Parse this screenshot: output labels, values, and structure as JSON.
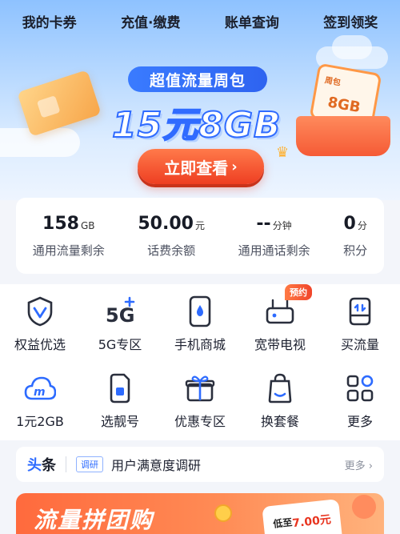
{
  "topnav": {
    "items": [
      "我的卡券",
      "充值·缴费",
      "账单查询",
      "签到领奖"
    ]
  },
  "hero": {
    "tag": "超值流量周包",
    "headline": "15元8GB",
    "gift_calendar_text": "8GB",
    "cta": "立即查看",
    "cta_chevron": "›"
  },
  "stats": [
    {
      "value": "158",
      "unit": "GB",
      "label": "通用流量剩余"
    },
    {
      "value": "50.00",
      "unit": "元",
      "label": "话费余额"
    },
    {
      "value": "--",
      "unit": "分钟",
      "label": "通用通话剩余"
    },
    {
      "value": "0",
      "unit": "分",
      "label": "积分"
    }
  ],
  "grid": {
    "row1": [
      {
        "label": "权益优选",
        "icon": "medal-icon"
      },
      {
        "label": "5G专区",
        "icon": "5g-icon"
      },
      {
        "label": "手机商城",
        "icon": "phone-icon"
      },
      {
        "label": "宽带电视",
        "icon": "router-icon",
        "badge": "预约"
      },
      {
        "label": "买流量",
        "icon": "data-box-icon"
      }
    ],
    "row2": [
      {
        "label": "1元2GB",
        "icon": "cloud-icon"
      },
      {
        "label": "选靓号",
        "icon": "sim-card-icon"
      },
      {
        "label": "优惠专区",
        "icon": "gift-icon"
      },
      {
        "label": "换套餐",
        "icon": "bag-icon"
      },
      {
        "label": "更多",
        "icon": "grid-icon"
      }
    ]
  },
  "news": {
    "brand_a": "头",
    "brand_b": "条",
    "tag": "调研",
    "title": "用户满意度调研",
    "more": "更多 ›"
  },
  "banner2": {
    "title": "流量拼团购",
    "price_prefix": "低至",
    "price_value": "7.00元"
  },
  "colors": {
    "accent": "#2d6bff",
    "cta": "#ee3e22",
    "badge": "#f0442a"
  }
}
